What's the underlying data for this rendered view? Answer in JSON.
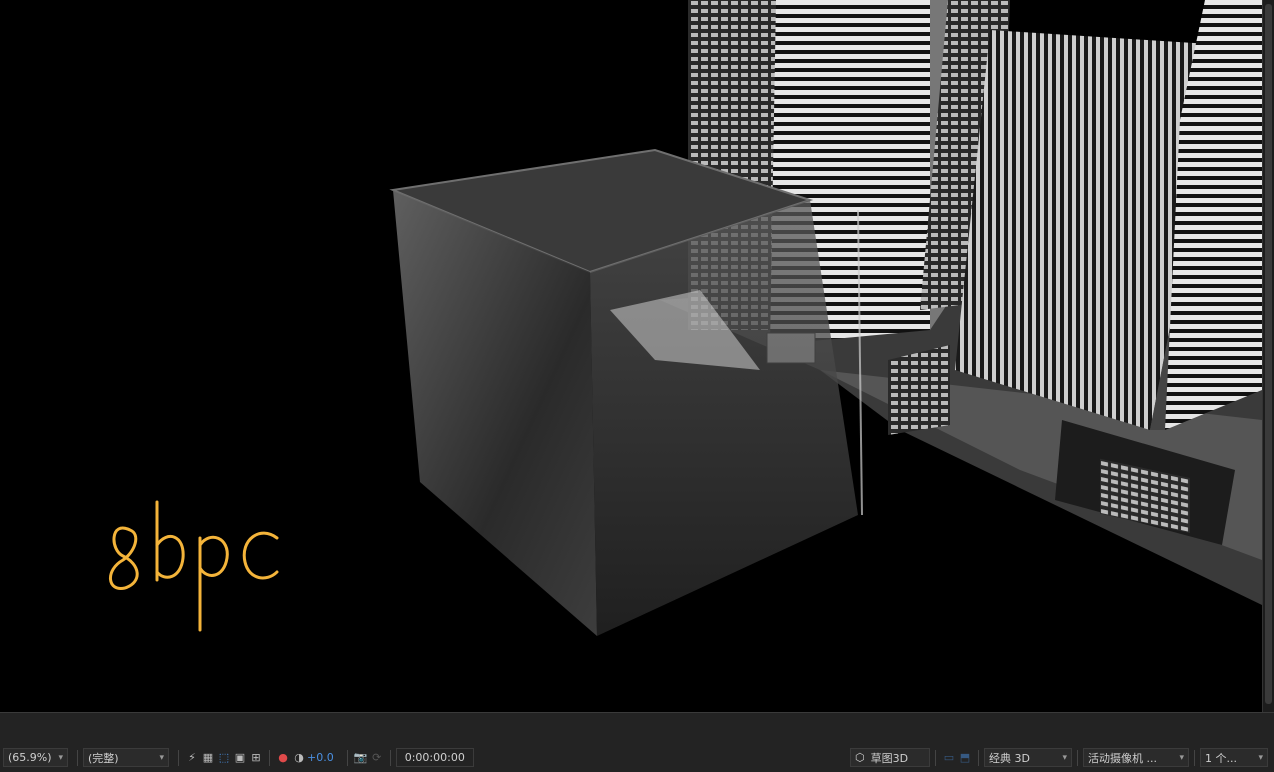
{
  "viewer": {
    "annotation_text": "8bpc"
  },
  "toolbar": {
    "zoom_value": "(65.9%)",
    "resolution_value": "(完整)",
    "exposure_value": "+0.0",
    "timecode": "0:00:00:00",
    "draft3d_label": "草图3D",
    "renderer_value": "经典 3D",
    "camera_value": "活动摄像机 ...",
    "views_value": "1 个...",
    "accent_color": "#4a8fe0"
  }
}
